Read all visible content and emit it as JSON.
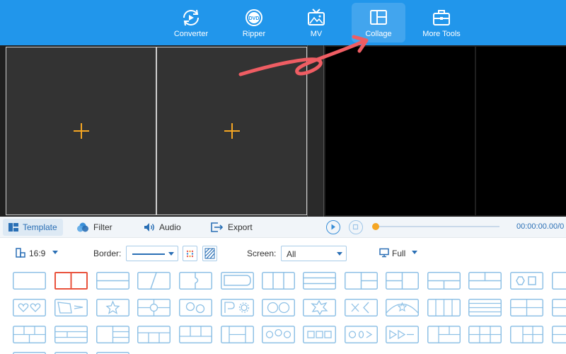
{
  "nav": {
    "items": [
      {
        "label": "Converter",
        "icon": "converter-icon"
      },
      {
        "label": "Ripper",
        "icon": "dvd-icon"
      },
      {
        "label": "MV",
        "icon": "tv-icon"
      },
      {
        "label": "Collage",
        "icon": "collage-icon",
        "active": true
      },
      {
        "label": "More Tools",
        "icon": "toolbox-icon"
      }
    ],
    "dvd_text": "DVD"
  },
  "tabs": [
    {
      "label": "Template",
      "icon": "template-icon",
      "active": true
    },
    {
      "label": "Filter",
      "icon": "filter-icon"
    },
    {
      "label": "Audio",
      "icon": "audio-icon"
    },
    {
      "label": "Export",
      "icon": "export-icon"
    }
  ],
  "player": {
    "time": "00:00:00.00/0",
    "progress": 0
  },
  "options": {
    "ratio": "16:9",
    "border_label": "Border:",
    "screen_label": "Screen:",
    "screen_value": "All",
    "display_value": "Full"
  },
  "colors": {
    "topbar": "#2196eb",
    "accent": "#f5a623",
    "selected_template": "#e9533d",
    "template_stroke": "#8fc1e6",
    "annotation_arrow": "#ef5d63"
  }
}
